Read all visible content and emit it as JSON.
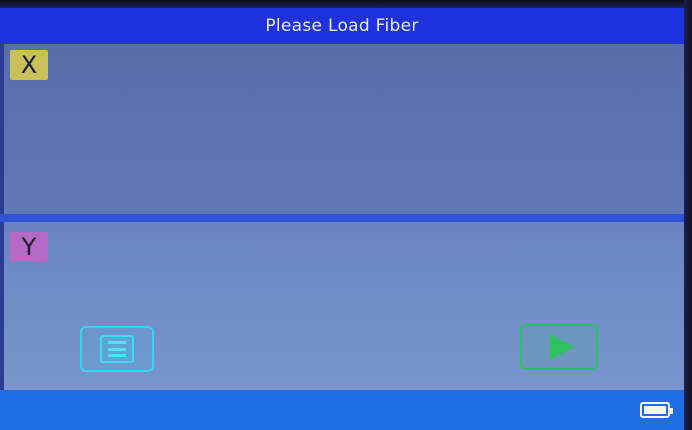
{
  "header": {
    "title": "Please Load Fiber"
  },
  "views": {
    "x": {
      "label": "X"
    },
    "y": {
      "label": "Y"
    }
  },
  "controls": {
    "menu_icon": "menu-icon",
    "start_icon": "play-icon"
  },
  "status": {
    "battery_level": 1.0
  },
  "colors": {
    "title_bar": "#1e32e0",
    "status_bar": "#1f6fe4",
    "x_label_bg": "#c9c05a",
    "y_label_bg": "#b46ac4",
    "menu_accent": "#35d6f0",
    "start_accent": "#2fbe66"
  }
}
